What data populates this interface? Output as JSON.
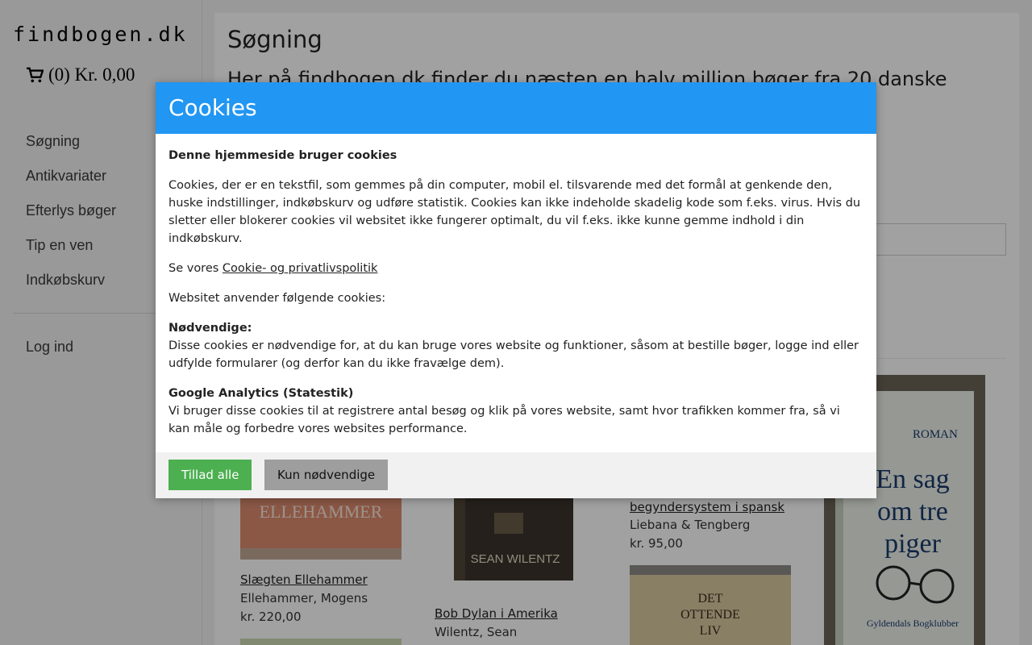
{
  "sidebar": {
    "logo": "findbogen.dk",
    "cart": "(0) Kr. 0,00",
    "nav": [
      "Søgning",
      "Antikvariater",
      "Efterlys bøger",
      "Tip en ven",
      "Indkøbskurv"
    ],
    "login": "Log ind"
  },
  "main": {
    "title": "Søgning",
    "lead": "Her på findbogen.dk finder du næsten en halv million bøger fra 20 danske"
  },
  "books": [
    {
      "title": "Slægten Ellehammer",
      "author": "Ellehammer, Mogens",
      "price": "kr. 220,00",
      "cover_text": "ELLEHAMMER"
    },
    {
      "title": "Bob Dylan i Amerika",
      "author": "Wilentz, Sean",
      "price": "",
      "cover_text": "SEAN WILENTZ"
    },
    {
      "title": "begyndersystem i spansk",
      "author": "Liebana & Tengberg",
      "price": "kr. 95,00",
      "cover_text": ""
    },
    {
      "title": "",
      "author": "",
      "price": "",
      "cover_text": "DET OTTENDE LIV"
    },
    {
      "title": "",
      "author": "",
      "price": "",
      "cover_text": "En sag om tre piger"
    }
  ],
  "cookie_modal": {
    "header": "Cookies",
    "heading": "Denne hjemmeside bruger cookies",
    "intro": "Cookies, der er en tekstfil, som gemmes på din computer, mobil el. tilsvarende med det formål at genkende den, huske indstillinger, indkøbskurv og udføre statistik. Cookies kan ikke indeholde skadelig kode som f.eks. virus. Hvis du sletter eller blokerer cookies vil websitet ikke fungerer optimalt, du vil f.eks. ikke kunne gemme indhold i din indkøbskurv.",
    "policy_prefix": "Se vores ",
    "policy_link": "Cookie- og privatlivspolitik",
    "uses": "Websitet anvender følgende cookies:",
    "necessary_title": "Nødvendige:",
    "necessary_text": "Disse cookies er nødvendige for, at du kan bruge vores website og funktioner, såsom at bestille bøger, logge ind eller udfylde formularer (og derfor kan du ikke fravælge dem).",
    "analytics_title": "Google Analytics (Statestik)",
    "analytics_text": "Vi bruger disse cookies til at registrere antal besøg og klik på vores website, samt hvor trafikken kommer fra, så vi kan måle og forbedre vores websites performance.",
    "allow_all": "Tillad alle",
    "only_necessary": "Kun nødvendige"
  },
  "colors": {
    "header_blue": "#2196f3",
    "allow_green": "#4caf50",
    "necessary_gray": "#9e9e9e"
  }
}
